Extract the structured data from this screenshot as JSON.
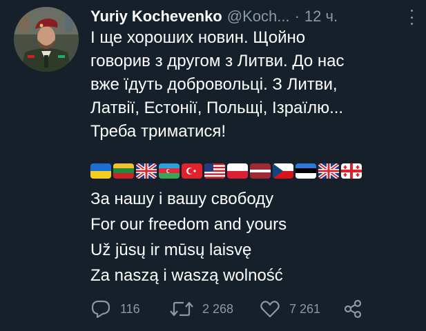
{
  "tweet": {
    "author_name": "Yuriy Kochevenko",
    "author_handle": "@Koch...",
    "separator": "·",
    "time": "12 ч.",
    "text_lines": [
      "І ще хороших новин. Щойно",
      "говорив з другом з Литви. До нас",
      "вже їдуть добровольці. З Литви,",
      "Латвії, Естонії, Польщі, Ізраїлю...",
      "Треба триматися!"
    ],
    "flags": [
      "ukraine-flag",
      "lithuania-flag",
      "uk-flag",
      "azerbaijan-flag",
      "turkey-flag",
      "usa-flag",
      "poland-flag",
      "latvia-flag",
      "czechia-flag",
      "estonia-flag",
      "uk-flag",
      "georgia-flag"
    ],
    "slogan_lines": [
      "За нашу і вашу свободу",
      "For our freedom and yours",
      "Už jūsų ir mūsų laisvę",
      "Za naszą i waszą wolność"
    ]
  },
  "actions": {
    "reply_count": "116",
    "retweet_count": "2 268",
    "like_count": "7 261"
  },
  "colors": {
    "background": "#15202b",
    "text": "#ffffff",
    "secondary_text": "#8b98a5"
  }
}
